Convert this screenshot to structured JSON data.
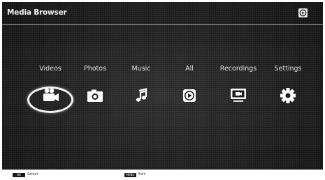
{
  "app": {
    "title": "Media Browser"
  },
  "menu": {
    "items": [
      {
        "label": "Videos",
        "icon": "video-camera-icon",
        "selected": true
      },
      {
        "label": "Photos",
        "icon": "camera-icon",
        "selected": false
      },
      {
        "label": "Music",
        "icon": "music-note-icon",
        "selected": false
      },
      {
        "label": "All",
        "icon": "play-all-icon",
        "selected": false
      },
      {
        "label": "Recordings",
        "icon": "recording-screen-icon",
        "selected": false
      },
      {
        "label": "Settings",
        "icon": "gear-icon",
        "selected": false
      }
    ]
  },
  "footer": {
    "select_key": "OK",
    "select_label": "Select",
    "exit_key": "MENU",
    "exit_label": "Exit"
  },
  "colors": {
    "background": "#1c1c1c",
    "text": "#e0e0e0",
    "accent": "#ffffff"
  }
}
